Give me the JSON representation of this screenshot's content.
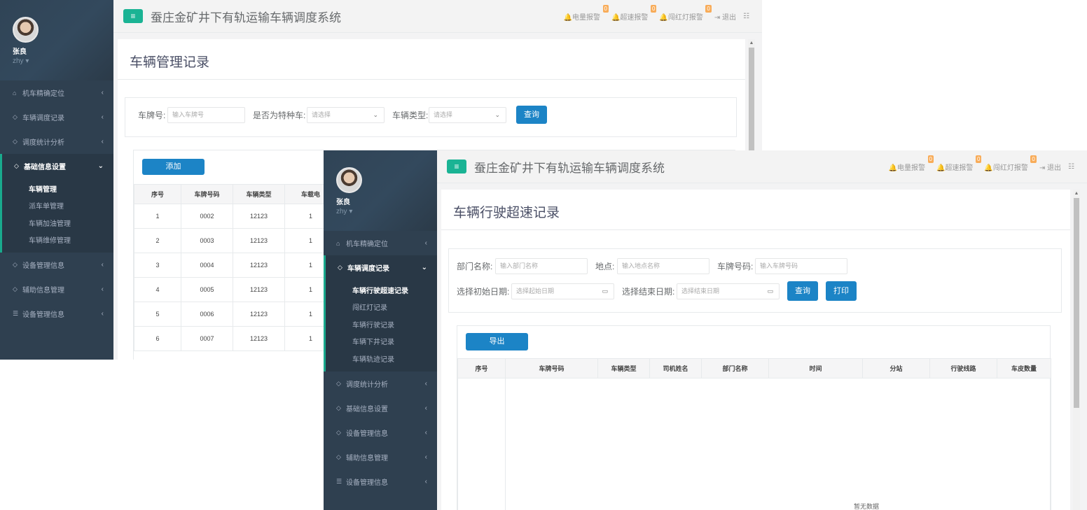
{
  "system_title": "蚕庄金矿井下有轨运输车辆调度系统",
  "alerts": {
    "power": "电量报警",
    "speed": "超速报警",
    "redlight": "闯红灯报警",
    "power_count": "0",
    "speed_count": "0",
    "redlight_count": "0",
    "logout": "退出"
  },
  "user": {
    "name": "张良",
    "account": "zhy"
  },
  "win1": {
    "menu": [
      "机车精确定位",
      "车辆调度记录",
      "调度统计分析",
      "基础信息设置",
      "设备管理信息",
      "辅助信息管理",
      "设备管理信息"
    ],
    "submenu": [
      "车辆管理",
      "派车单管理",
      "车辆加油管理",
      "车辆维修管理"
    ],
    "page_title": "车辆管理记录",
    "form": {
      "plate_label": "车牌号:",
      "plate_placeholder": "输入车牌号",
      "special_label": "是否为特种车:",
      "special_value": "请选择",
      "type_label": "车辆类型:",
      "type_value": "请选择",
      "query": "查询"
    },
    "add_button": "添加",
    "columns": [
      "序号",
      "车牌号码",
      "车辆类型",
      "车载电"
    ],
    "rows": [
      [
        "1",
        "0002",
        "12123",
        "1"
      ],
      [
        "2",
        "0003",
        "12123",
        "1"
      ],
      [
        "3",
        "0004",
        "12123",
        "1"
      ],
      [
        "4",
        "0005",
        "12123",
        "1"
      ],
      [
        "5",
        "0006",
        "12123",
        "1"
      ],
      [
        "6",
        "0007",
        "12123",
        "1"
      ]
    ]
  },
  "win2": {
    "menu_top": [
      "机车精确定位",
      "车辆调度记录"
    ],
    "submenu": [
      "车辆行驶超速记录",
      "闯红灯记录",
      "车辆行驶记录",
      "车辆下井记录",
      "车辆轨迹记录"
    ],
    "menu_bottom": [
      "调度统计分析",
      "基础信息设置",
      "设备管理信息",
      "辅助信息管理",
      "设备管理信息"
    ],
    "page_title": "车辆行驶超速记录",
    "form": {
      "dept_label": "部门名称:",
      "dept_placeholder": "输入部门名称",
      "place_label": "地点:",
      "place_placeholder": "输入地点名称",
      "plate_label": "车牌号码:",
      "plate_placeholder": "输入车牌号码",
      "start_label": "选择初始日期:",
      "start_placeholder": "选择起始日期",
      "end_label": "选择结束日期:",
      "end_placeholder": "选择结束日期",
      "query": "查询",
      "print": "打印"
    },
    "export_button": "导出",
    "columns": [
      "序号",
      "车牌号码",
      "车辆类型",
      "司机姓名",
      "部门名称",
      "时间",
      "分站",
      "行驶线路",
      "车皮数量"
    ],
    "empty": "暂无数据"
  }
}
